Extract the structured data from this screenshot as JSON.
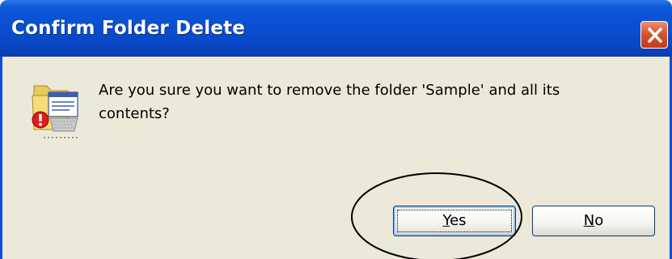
{
  "window": {
    "title": "Confirm Folder Delete"
  },
  "icons": {
    "close": "close-icon",
    "dialog": "folder-delete-warning-icon"
  },
  "message": {
    "text": "Are you sure you want to remove the folder 'Sample' and all its contents?"
  },
  "buttons": {
    "yes_accel": "Y",
    "yes_rest": "es",
    "no_accel": "N",
    "no_rest": "o"
  },
  "colors": {
    "titlebar": "#0a4fd0",
    "body_background": "#ece9d8",
    "close_button": "#d4502a"
  }
}
